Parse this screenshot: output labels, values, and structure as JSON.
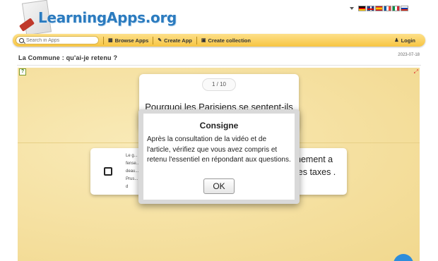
{
  "header": {
    "logo_text": "LearningApps.org",
    "languages": [
      "de",
      "gb",
      "es",
      "fr",
      "it",
      "ru"
    ]
  },
  "navbar": {
    "search_placeholder": "Search in Apps",
    "browse": "Browse Apps",
    "create": "Create App",
    "collection": "Create collection",
    "login": "Login"
  },
  "page": {
    "title": "La Commune : qu'ai-je retenu ?",
    "date": "2023-07-18"
  },
  "quiz": {
    "counter": "1 / 10",
    "question": "Pourquoi les Parisiens se sentent-ils",
    "answer_left": "Le g... fense... deau... Prus... ont d",
    "answer_right": "nement a les taxes ."
  },
  "dialog": {
    "title": "Consigne",
    "text": "Après la consultation de la vidéo et de l'article, vérifiez que vous avez compris et retenu l'essentiel en répondant aux questions.",
    "ok": "OK"
  },
  "colors": {
    "navbar": "#f7c542",
    "app_bg": "#f5e0a0",
    "logo": "#2b7bbf",
    "fab": "#2e8ddb"
  }
}
